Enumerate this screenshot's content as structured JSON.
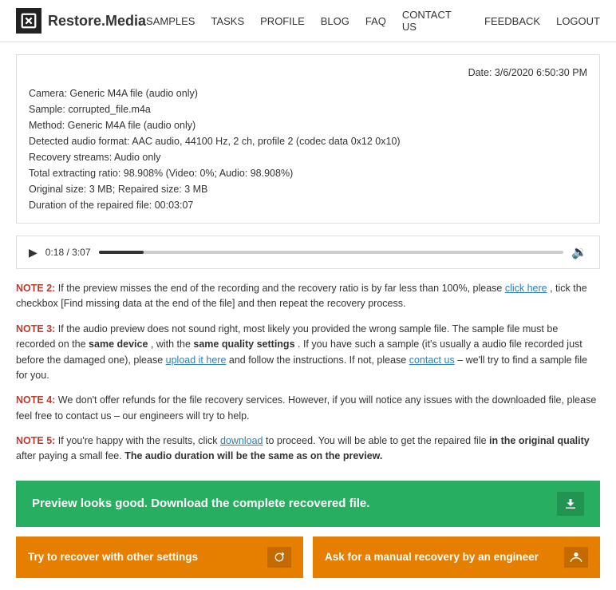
{
  "header": {
    "logo_text": "Restore.Media",
    "nav_items": [
      "SAMPLES",
      "TASKS",
      "PROFILE",
      "BLOG",
      "FAQ",
      "CONTACT US",
      "FEEDBACK",
      "LOGOUT"
    ]
  },
  "info": {
    "date_label": "Date: 3/6/2020 6:50:30 PM",
    "lines": [
      "Camera: Generic M4A file (audio only)",
      "Sample: corrupted_file.m4a",
      "Method: Generic M4A file (audio only)",
      "Detected audio format: AAC audio, 44100 Hz, 2 ch, profile 2 (codec data 0x12 0x10)",
      "Recovery streams: Audio only",
      "Total extracting ratio: 98.908% (Video: 0%; Audio: 98.908%)",
      "Original size: 3 MB; Repaired size: 3 MB",
      "Duration of the repaired file: 00:03:07"
    ]
  },
  "player": {
    "time_current": "0:18",
    "time_total": "3:07",
    "progress_percent": 9.7
  },
  "notes": [
    {
      "label": "NOTE 2:",
      "text_before": " If the preview misses the end of the recording and the recovery ratio is by far less than 100%, please ",
      "link_text": "click here",
      "text_after": ", tick the checkbox [Find missing data at the end of the file] and then repeat the recovery process."
    },
    {
      "label": "NOTE 3:",
      "text": " If the audio preview does not sound right, most likely you provided the wrong sample file. The sample file must be recorded on the ",
      "bold1": "same device",
      "text2": ", with the ",
      "bold2": "same quality settings",
      "text3": ". If you have such a sample (it's usually a audio file recorded just before the damaged one), please ",
      "link1_text": "upload it here",
      "text4": " and follow the instructions. If not, please ",
      "link2_text": "contact us",
      "text5": " – we'll try to find a sample file for you."
    },
    {
      "label": "NOTE 4:",
      "text": " We don't offer refunds for the file recovery services. However, if you will notice any issues with the downloaded file, please feel free to contact us – our engineers will try to help."
    },
    {
      "label": "NOTE 5:",
      "text_before": " If you're happy with the results, click ",
      "link_text": "download",
      "text_after_link": " to proceed. You will be able to get the repaired file ",
      "bold1": "in the original quality",
      "text_mid": " after paying a small fee. ",
      "bold2": "The audio duration will be the same as on the preview."
    }
  ],
  "buttons": {
    "green": "Preview looks good. Download the complete recovered file.",
    "orange1": "Try to recover with other settings",
    "orange2": "Ask for a manual recovery by an engineer"
  }
}
